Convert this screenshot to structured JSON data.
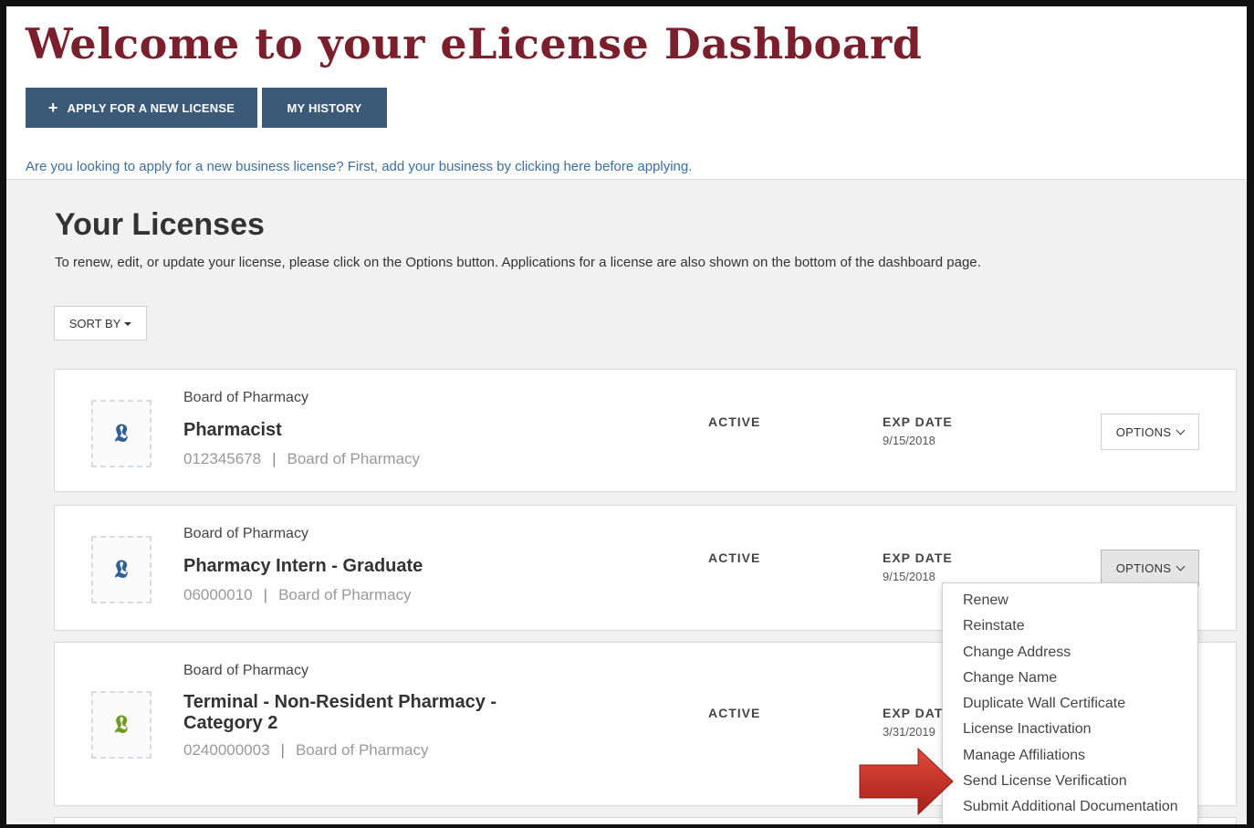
{
  "header": {
    "title": "Welcome to your eLicense Dashboard",
    "apply_label": "APPLY FOR A NEW LICENSE",
    "history_label": "MY HISTORY",
    "business_link": "Are you looking to apply for a new business license? First, add your business by clicking here before applying."
  },
  "licenses_section": {
    "heading": "Your Licenses",
    "instructions": "To renew, edit, or update your license, please click on the Options button. Applications for a license are also shown on the bottom of the dashboard page.",
    "sort_label": "SORT BY"
  },
  "licenses": [
    {
      "board": "Board of Pharmacy",
      "title": "Pharmacist",
      "number": "012345678",
      "sep": "|",
      "board_meta": "Board of Pharmacy",
      "status": "ACTIVE",
      "exp_label": "EXP DATE",
      "exp_date": "9/15/2018",
      "options_label": "OPTIONS",
      "icon": "license-seal-icon",
      "icon_color": "#2f5f94"
    },
    {
      "board": "Board of Pharmacy",
      "title": "Pharmacy Intern - Graduate",
      "number": "06000010",
      "sep": "|",
      "board_meta": "Board of Pharmacy",
      "status": "ACTIVE",
      "exp_label": "EXP DATE",
      "exp_date": "9/15/2018",
      "options_label": "OPTIONS",
      "icon": "license-seal-icon",
      "icon_color": "#2f5f94"
    },
    {
      "board": "Board of Pharmacy",
      "title": "Terminal - Non-Resident Pharmacy - Category 2",
      "number": "0240000003",
      "sep": "|",
      "board_meta": "Board of Pharmacy",
      "status": "ACTIVE",
      "exp_label": "EXP DAT",
      "exp_date": "3/31/2019",
      "icon": "license-seal-icon",
      "icon_color": "#6e9a1e"
    }
  ],
  "options_menu": {
    "items": [
      "Renew",
      "Reinstate",
      "Change Address",
      "Change Name",
      "Duplicate Wall Certificate",
      "License Inactivation",
      "Manage Affiliations",
      "Send License Verification",
      "Submit Additional Documentation"
    ]
  },
  "colors": {
    "title": "#7b1f2c",
    "primary_button": "#3a5a78",
    "link": "#3c6e9e",
    "annotation_arrow": "#c62828"
  },
  "icons": {
    "plus": "plus-icon",
    "sort_caret": "caret-down-icon",
    "options_chevron": "chevron-down-icon",
    "annotation": "red-arrow-icon"
  }
}
